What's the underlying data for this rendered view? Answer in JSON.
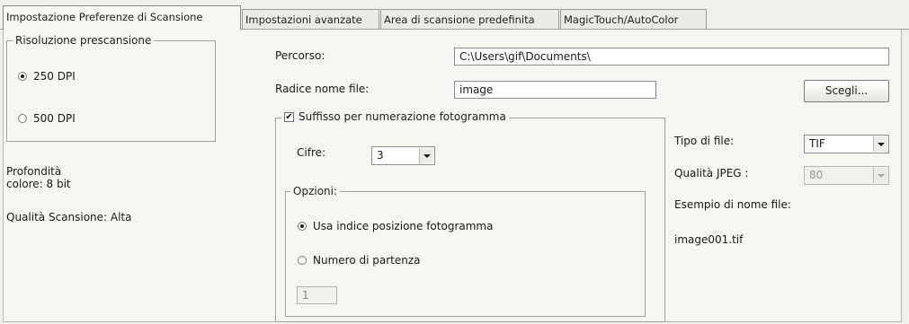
{
  "tabs": [
    {
      "label": "Impostazione Preferenze di Scansione"
    },
    {
      "label": "Impostazioni avanzate"
    },
    {
      "label": "Area di scansione predefinita"
    },
    {
      "label": "MagicTouch/AutoColor"
    }
  ],
  "resolution": {
    "legend": "Risoluzione prescansione",
    "options": [
      {
        "label": "250 DPI",
        "selected": true
      },
      {
        "label": "500 DPI",
        "selected": false
      }
    ]
  },
  "info": {
    "depth_line1": "Profondità",
    "depth_line2": "colore: 8 bit",
    "quality": "Qualità Scansione: Alta"
  },
  "path": {
    "label": "Percorso:",
    "value": "C:\\Users\\gif\\Documents\\"
  },
  "filename_root": {
    "label": "Radice nome file:",
    "value": "image"
  },
  "choose_button": "Scegli...",
  "suffix": {
    "label": "Suffisso per numerazione fotogramma",
    "checked": true,
    "digits_label": "Cifre:",
    "digits_value": "3",
    "options_legend": "Opzioni:",
    "options": [
      {
        "label": "Usa indice posizione fotogramma",
        "selected": true
      },
      {
        "label": "Numero di partenza",
        "selected": false
      }
    ],
    "start_value": "1"
  },
  "file_type": {
    "label": "Tipo di file:",
    "value": "TIF"
  },
  "jpeg_quality": {
    "label": "Qualità JPEG :",
    "value": "80"
  },
  "example": {
    "label": "Esempio di nome file:",
    "value": "image001.tif"
  }
}
